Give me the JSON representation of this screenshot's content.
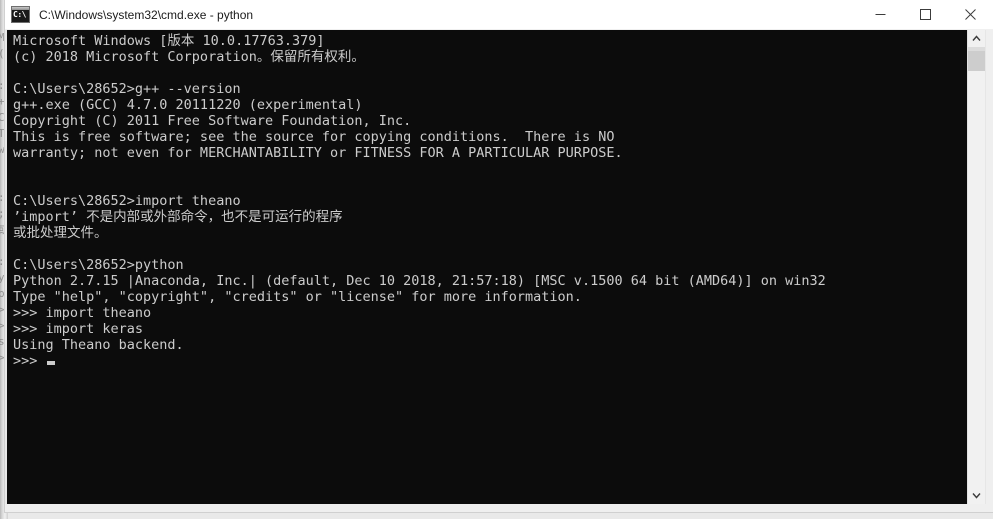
{
  "window": {
    "title": "C:\\Windows\\system32\\cmd.exe - python",
    "icon": "cmd-console-icon",
    "icon_glyph": "C:\\",
    "controls": {
      "minimize_label": "Minimize",
      "maximize_label": "Maximize",
      "close_label": "Close"
    },
    "colors": {
      "titlebar_bg": "#ffffff",
      "title_text": "#1b1b1b",
      "console_bg": "#0c0c0c",
      "console_text": "#cccccc",
      "scrollbar_track": "#f1f1f1",
      "scrollbar_thumb": "#cdcdcd"
    }
  },
  "console": {
    "lines": [
      "Microsoft Windows [版本 10.0.17763.379]",
      "(c) 2018 Microsoft Corporation。保留所有权利。",
      "",
      "C:\\Users\\28652>g++ --version",
      "g++.exe (GCC) 4.7.0 20111220 (experimental)",
      "Copyright (C) 2011 Free Software Foundation, Inc.",
      "This is free software; see the source for copying conditions.  There is NO",
      "warranty; not even for MERCHANTABILITY or FITNESS FOR A PARTICULAR PURPOSE.",
      "",
      "",
      "C:\\Users\\28652>import theano",
      "’import’ 不是内部或外部命令，也不是可运行的程序",
      "或批处理文件。",
      "",
      "C:\\Users\\28652>python",
      "Python 2.7.15 |Anaconda, Inc.| (default, Dec 10 2018, 21:57:18) [MSC v.1500 64 bit (AMD64)] on win32",
      "Type \"help\", \"copyright\", \"credits\" or \"license\" for more information.",
      ">>> import theano",
      ">>> import keras",
      "Using Theano backend."
    ],
    "prompt_last": ">>> ",
    "cursor": "block-cursor"
  },
  "scrollbar": {
    "up_arrow": "chevron-up-icon",
    "down_arrow": "chevron-down-icon",
    "thumb_label": "scroll-thumb"
  },
  "background_window": {
    "edge_glyphs": "M\n(\n\n:\n+\nC\nT\nw\n\n\n:\n;\n或\n\n:\ny\np\n>\n>\ns\n>"
  }
}
